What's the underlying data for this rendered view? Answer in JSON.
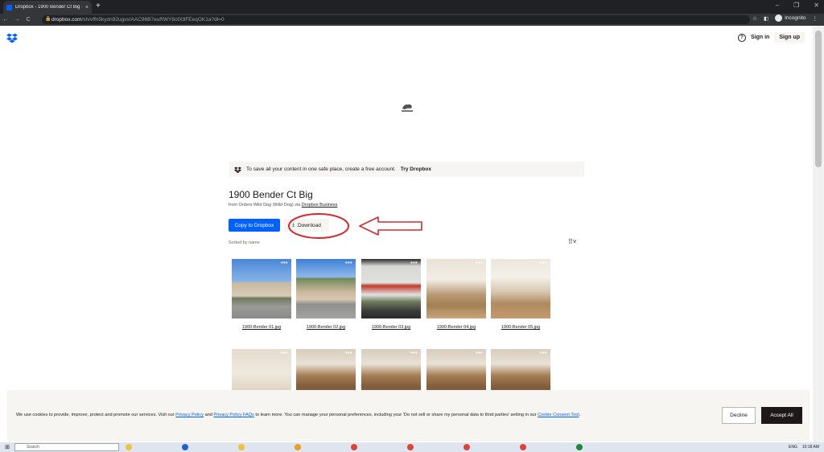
{
  "browser": {
    "tab_title": "Dropbox - 1900 Bender Ct Big - ",
    "tab_close": "×",
    "new_tab": "+",
    "url_domain": "dropbox.com",
    "url_path": "/sh/vffn5kydn92ugvx/AAC96B7euRWY8ofX9FEeqGK1a?dl=0",
    "profile_label": "Incognito",
    "nav_back": "←",
    "nav_forward": "→",
    "nav_reload": "C",
    "star_icon": "☆",
    "menu_icon": "⋮"
  },
  "header": {
    "sign_in": "Sign in",
    "sign_up": "Sign up"
  },
  "banner": {
    "text": "To save all your content in one safe place, create a free account.",
    "link": "Try Dropbox"
  },
  "folder": {
    "title": "1900 Bender Ct Big",
    "subtitle_prefix": "from Orders Wild Dog (Wild Dog) via",
    "subtitle_link": "Dropbox Business",
    "copy_button": "Copy to Dropbox",
    "download_button": "Download",
    "sorted_label": "Sorted by name"
  },
  "files": [
    {
      "name": "1900-Bender 01.jpg"
    },
    {
      "name": "1900-Bender 02.jpg"
    },
    {
      "name": "1900-Bender 03.jpg"
    },
    {
      "name": "1900-Bender 04.jpg"
    },
    {
      "name": "1900-Bender 05.jpg"
    }
  ],
  "more_label": "•••",
  "cookie": {
    "text_1": "We use cookies to provide, improve, protect and promote our services. Visit our",
    "link_1": "Privacy Policy",
    "text_2": "and",
    "link_2": "Privacy Policy FAQs",
    "text_3": "to learn more. You can manage your personal preferences, including your 'Do not sell or share my personal data to third parties' setting in our",
    "link_3": "Cookie Consent Tool",
    "text_4": ".",
    "decline": "Decline",
    "accept": "Accept All"
  },
  "taskbar": {
    "search_placeholder": "Search",
    "lang": "ENG",
    "time": "10:18 AM"
  },
  "colors": {
    "dropbox_blue": "#0061fe",
    "annotation_red": "#d7282f"
  }
}
